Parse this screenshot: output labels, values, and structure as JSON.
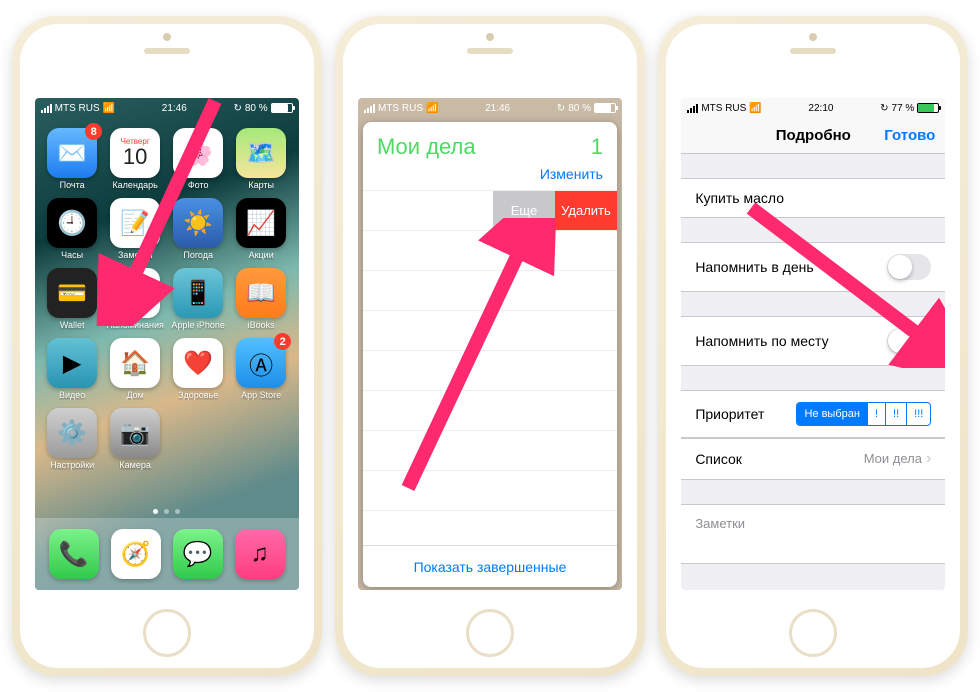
{
  "status": {
    "carrier": "MTS RUS",
    "time1": "21:46",
    "time3": "22:10",
    "bat1": "80 %",
    "bat3": "77 %"
  },
  "p1": {
    "apps": [
      {
        "l": "Почта",
        "c": "linear-gradient(#66b8ff,#1e7cf0)",
        "t": "✉️",
        "b": "8"
      },
      {
        "l": "Календарь",
        "c": "#fff",
        "cal": {
          "d": "Четверг",
          "n": "10"
        }
      },
      {
        "l": "Фото",
        "c": "#fff",
        "t": "🌸"
      },
      {
        "l": "Карты",
        "c": "linear-gradient(#a5e87a,#f6e69a)",
        "t": "🗺️"
      },
      {
        "l": "Часы",
        "c": "#000",
        "t": "🕘"
      },
      {
        "l": "Заметки",
        "c": "#fff",
        "t": "📝"
      },
      {
        "l": "Погода",
        "c": "linear-gradient(#4a90e2,#2a5caa)",
        "t": "☀️"
      },
      {
        "l": "Акции",
        "c": "#000",
        "t": "📈"
      },
      {
        "l": "Wallet",
        "c": "#222",
        "t": "💳"
      },
      {
        "l": "Напоминания",
        "c": "#fff",
        "t": ""
      },
      {
        "l": "Apple iPhone",
        "c": "linear-gradient(#6cc5d8,#2a98b5)",
        "t": "📱"
      },
      {
        "l": "iBooks",
        "c": "linear-gradient(#ff9a3c,#ff7b1c)",
        "t": "📖"
      },
      {
        "l": "Видео",
        "c": "linear-gradient(#62c1d6,#2a94b2)",
        "t": "▶"
      },
      {
        "l": "Дом",
        "c": "#fff",
        "t": "🏠"
      },
      {
        "l": "Здоровье",
        "c": "#fff",
        "t": "❤️"
      },
      {
        "l": "App Store",
        "c": "linear-gradient(#4fc0ff,#1e8fe8)",
        "t": "Ⓐ",
        "b": "2"
      },
      {
        "l": "Настройки",
        "c": "linear-gradient(#cfcfcf,#9b9b9b)",
        "t": "⚙️"
      },
      {
        "l": "Камера",
        "c": "linear-gradient(#cfcfcf,#898989)",
        "t": "📷"
      }
    ],
    "dock": [
      {
        "c": "linear-gradient(#7df28b,#2fcb4a)",
        "t": "📞"
      },
      {
        "c": "#fff",
        "t": "🧭"
      },
      {
        "c": "linear-gradient(#7df28b,#2fcb4a)",
        "t": "💬"
      },
      {
        "c": "linear-gradient(#ff6aa8,#ff3d7f)",
        "t": "♫"
      }
    ]
  },
  "p2": {
    "title": "Мои дела",
    "count": "1",
    "edit": "Изменить",
    "more": "Еще",
    "delete": "Удалить",
    "footer": "Показать завершенные"
  },
  "p3": {
    "nav_title": "Подробно",
    "nav_done": "Готово",
    "task": "Купить масло",
    "remind_day": "Напомнить в день",
    "remind_loc": "Напомнить по месту",
    "priority": "Приоритет",
    "seg": [
      "Не выбран",
      "!",
      "!!",
      "!!!"
    ],
    "list": "Список",
    "list_val": "Мои дела",
    "notes": "Заметки"
  }
}
